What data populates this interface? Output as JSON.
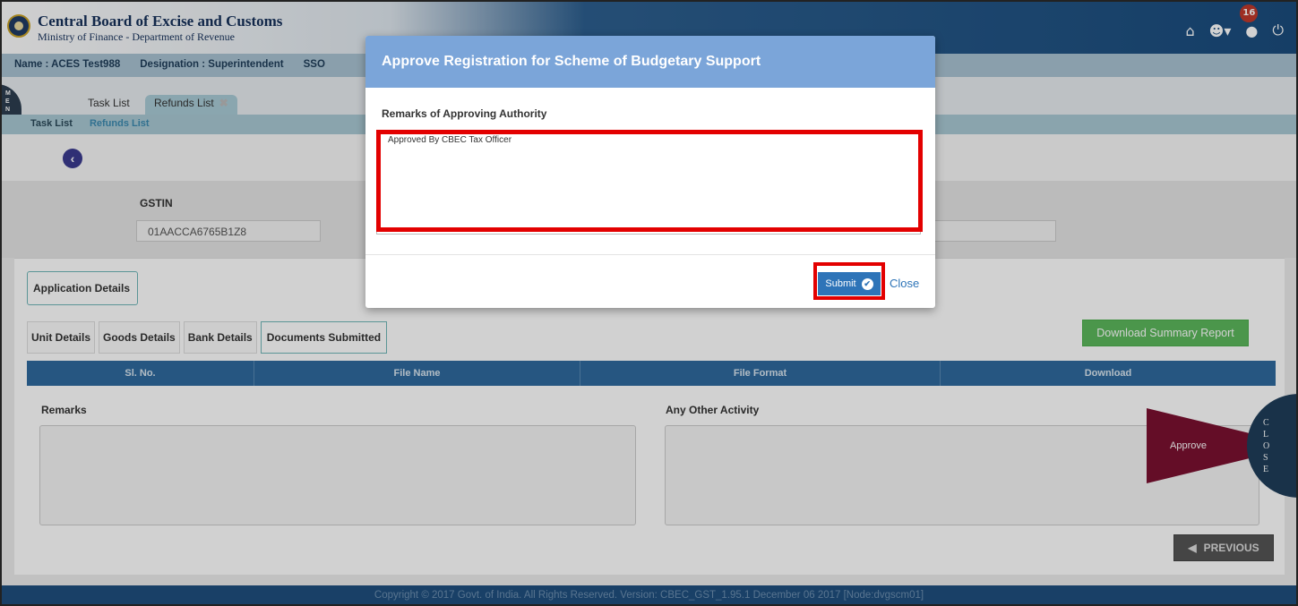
{
  "header": {
    "title": "Central Board of Excise and Customs",
    "subtitle": "Ministry of Finance - Department of Revenue",
    "notification_count": "16",
    "icons": [
      "home-icon",
      "user-icon",
      "alert-icon",
      "power-icon"
    ]
  },
  "infobar": {
    "name": "Name : ACES Test988",
    "designation": "Designation : Superintendent",
    "sso": "SSO"
  },
  "menu": {
    "label": "MENU"
  },
  "tabs": [
    {
      "label": "Task List"
    },
    {
      "label": "Refunds List"
    }
  ],
  "breadcrumb": [
    "Task List",
    "Refunds List"
  ],
  "gstin": {
    "label": "GSTIN",
    "value": "01AACCA6765B1Z8"
  },
  "main": {
    "application_details": "Application Details",
    "subtabs": [
      "Unit Details",
      "Goods Details",
      "Bank Details",
      "Documents Submitted"
    ],
    "download_button": "Download Summary Report",
    "table_headers": [
      "Sl. No.",
      "File Name",
      "File Format",
      "Download"
    ],
    "remarks_label": "Remarks",
    "other_activity_label": "Any Other Activity",
    "previous_button": "PREVIOUS",
    "approve_label": "Approve",
    "close_label": "CLOSE"
  },
  "footer": {
    "text": "Copyright © 2017 Govt. of India. All Rights Reserved. Version: CBEC_GST_1.95.1 December 06 2017    [Node:dvgscm01]"
  },
  "modal": {
    "title": "Approve Registration for Scheme of Budgetary Support",
    "remarks_label": "Remarks of Approving Authority",
    "remarks_value": "Approved By CBEC Tax Officer",
    "submit_label": "Submit",
    "close_label": "Close"
  },
  "colors": {
    "header_dark": "#1a4c7d",
    "modal_header": "#7ba5d9",
    "highlight": "#e30000",
    "submit": "#2e74b8",
    "download": "#5cb85c",
    "approve": "#7a1030"
  }
}
